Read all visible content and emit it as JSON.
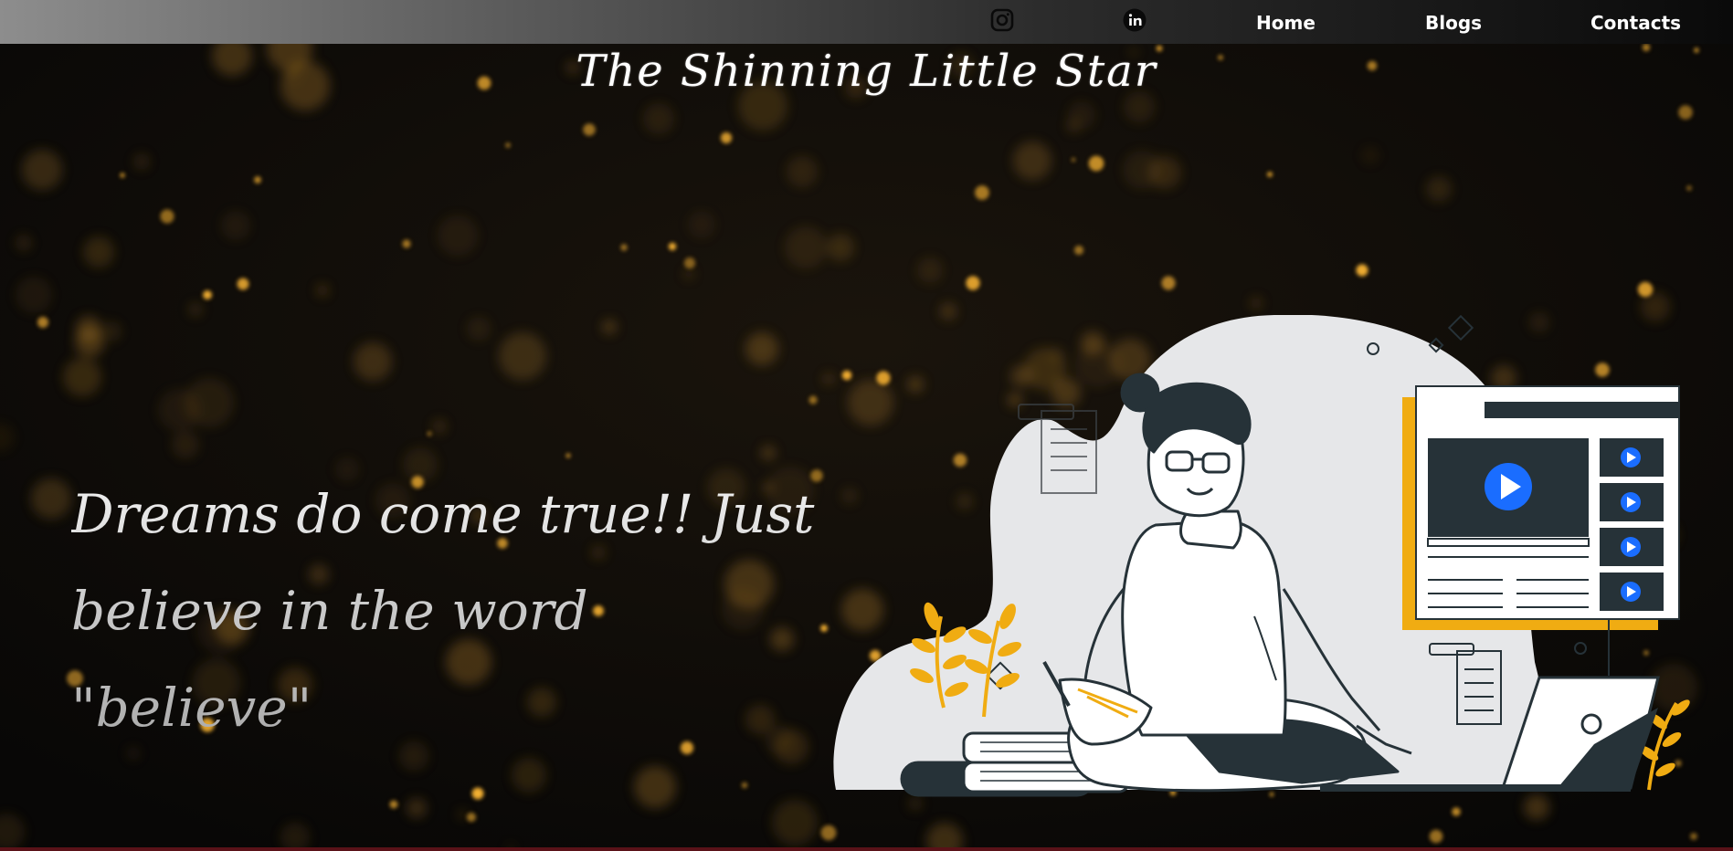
{
  "nav": {
    "social": [
      {
        "name": "instagram",
        "icon": "instagram-icon"
      },
      {
        "name": "linkedin",
        "icon": "linkedin-icon"
      }
    ],
    "links": [
      "Home",
      "Blogs",
      "Contacts"
    ]
  },
  "site": {
    "title": "The Shinning  Little Star",
    "tagline_line1": "Dreams do come true!! Just",
    "tagline_line2": "believe in the word \"believe\""
  },
  "hero": {
    "illustration": "woman-studying-online-illustration",
    "icons": [
      "play-icon"
    ]
  },
  "colors": {
    "background": "#0b0907",
    "bokeh": "#f2a92b",
    "accent": "#f0ac12",
    "video_blue": "#1a6dff",
    "dark": "#263238",
    "blob": "#e6e7e9"
  }
}
